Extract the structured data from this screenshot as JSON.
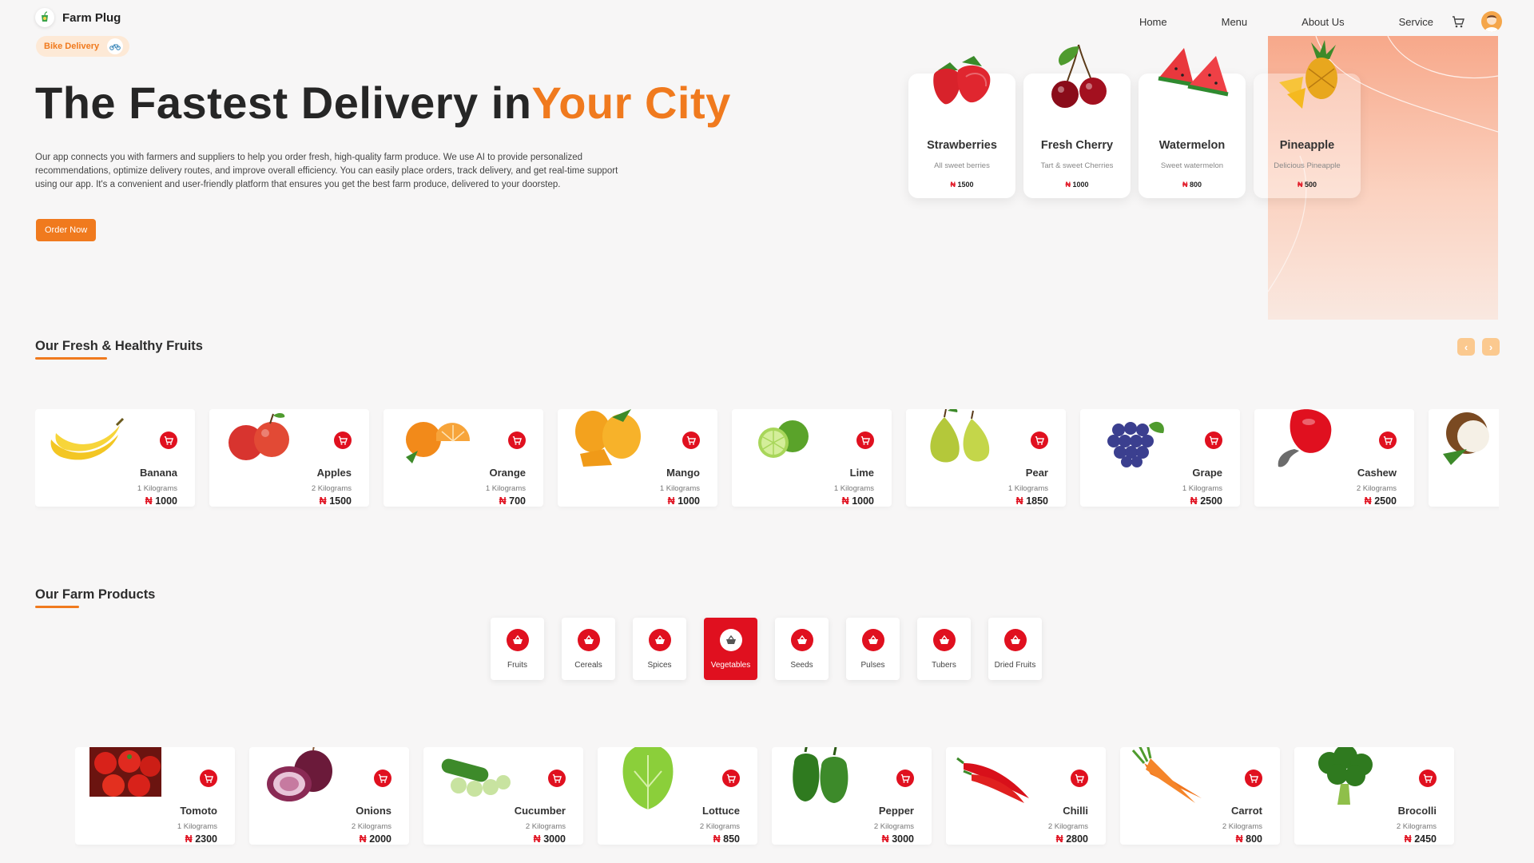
{
  "header": {
    "brand": "Farm Plug",
    "nav": [
      "Home",
      "Menu",
      "About Us",
      "Service"
    ]
  },
  "hero": {
    "badge": "Bike Delivery",
    "title_main": "The Fastest Delivery in",
    "title_accent": "Your City",
    "description": "Our app connects you with farmers and suppliers to help you order fresh, high-quality farm produce. We use AI to provide personalized recommendations, optimize delivery routes, and improve overall efficiency. You can easily place orders, track delivery, and get real-time support using our app. It's a convenient and user-friendly platform that ensures you get the best farm produce, delivered to your doorstep.",
    "cta": "Order Now",
    "cards": [
      {
        "name": "Strawberries",
        "sub": "All sweet berries",
        "price": "1500",
        "icon": "strawberry-icon"
      },
      {
        "name": "Fresh Cherry",
        "sub": "Tart & sweet Cherries",
        "price": "1000",
        "icon": "cherry-icon"
      },
      {
        "name": "Watermelon",
        "sub": "Sweet watermelon",
        "price": "800",
        "icon": "watermelon-icon"
      },
      {
        "name": "Pineapple",
        "sub": "Delicious Pineapple",
        "price": "500",
        "icon": "pineapple-icon"
      }
    ]
  },
  "currency": "₦",
  "fruits": {
    "title": "Our Fresh & Healthy Fruits",
    "items": [
      {
        "name": "Banana",
        "qty": "1 Kilograms",
        "price": "1000",
        "icon": "banana-icon"
      },
      {
        "name": "Apples",
        "qty": "2 Kilograms",
        "price": "1500",
        "icon": "apple-icon"
      },
      {
        "name": "Orange",
        "qty": "1 Kilograms",
        "price": "700",
        "icon": "orange-icon"
      },
      {
        "name": "Mango",
        "qty": "1 Kilograms",
        "price": "1000",
        "icon": "mango-icon"
      },
      {
        "name": "Lime",
        "qty": "1 Kilograms",
        "price": "1000",
        "icon": "lime-icon"
      },
      {
        "name": "Pear",
        "qty": "1 Kilograms",
        "price": "1850",
        "icon": "pear-icon"
      },
      {
        "name": "Grape",
        "qty": "1 Kilograms",
        "price": "2500",
        "icon": "grape-icon"
      },
      {
        "name": "Cashew",
        "qty": "2 Kilograms",
        "price": "2500",
        "icon": "cashew-icon"
      }
    ]
  },
  "farm": {
    "title": "Our Farm Products",
    "categories": [
      "Fruits",
      "Cereals",
      "Spices",
      "Vegetables",
      "Seeds",
      "Pulses",
      "Tubers",
      "Dried Fruits"
    ],
    "active_category": "Vegetables",
    "items": [
      {
        "name": "Tomoto",
        "qty": "1 Kilograms",
        "price": "2300",
        "icon": "tomato-icon"
      },
      {
        "name": "Onions",
        "qty": "2 Kilograms",
        "price": "2000",
        "icon": "onion-icon"
      },
      {
        "name": "Cucumber",
        "qty": "2 Kilograms",
        "price": "3000",
        "icon": "cucumber-icon"
      },
      {
        "name": "Lottuce",
        "qty": "2 Kilograms",
        "price": "850",
        "icon": "lettuce-icon"
      },
      {
        "name": "Pepper",
        "qty": "2 Kilograms",
        "price": "3000",
        "icon": "pepper-icon"
      },
      {
        "name": "Chilli",
        "qty": "2 Kilograms",
        "price": "2800",
        "icon": "chilli-icon"
      },
      {
        "name": "Carrot",
        "qty": "2 Kilograms",
        "price": "800",
        "icon": "carrot-icon"
      },
      {
        "name": "Brocolli",
        "qty": "2 Kilograms",
        "price": "2450",
        "icon": "broccoli-icon"
      }
    ]
  },
  "colors": {
    "accent": "#f07a1e",
    "cart": "#e0101f"
  }
}
